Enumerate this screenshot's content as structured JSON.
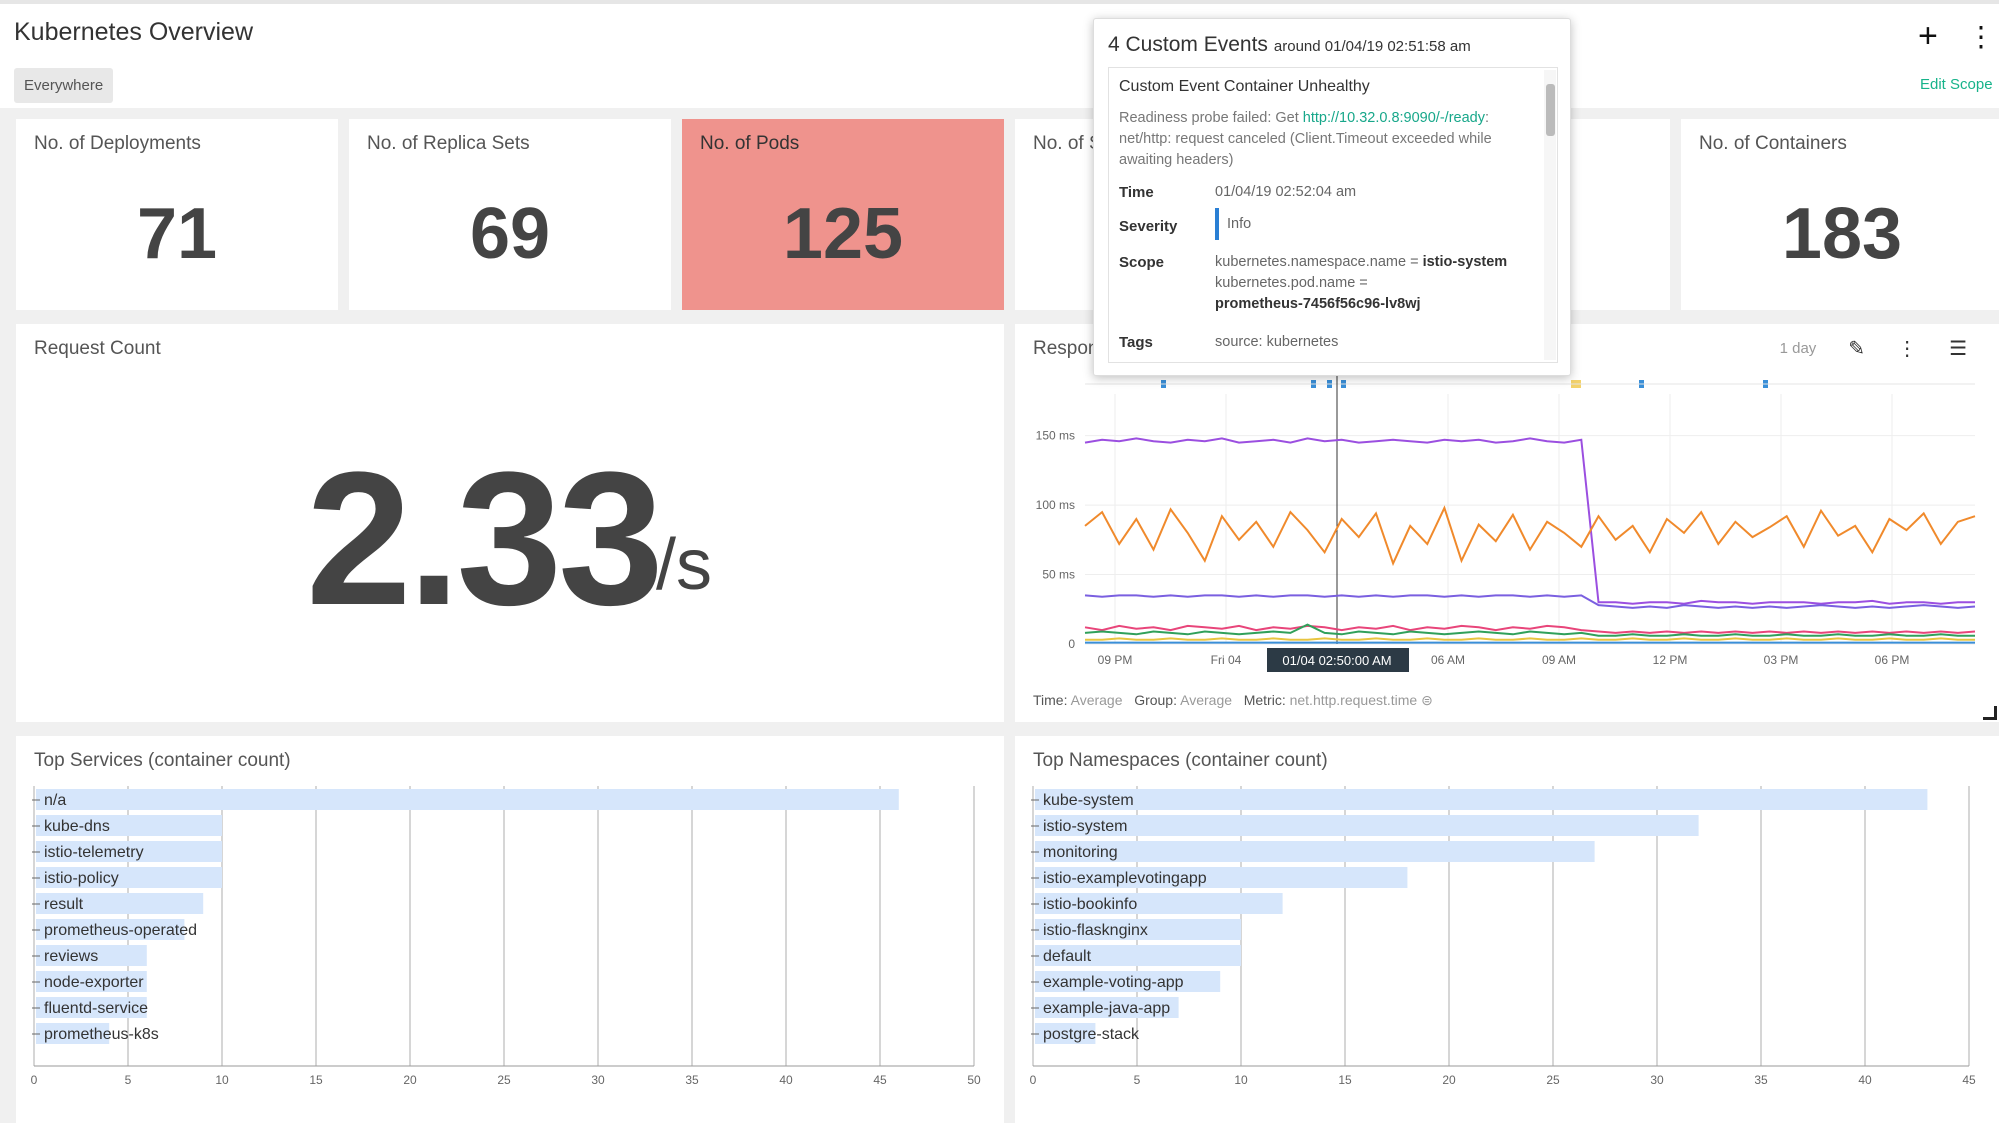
{
  "header": {
    "title": "Kubernetes Overview",
    "scope_chip": "Everywhere",
    "add_icon": "plus-icon",
    "more_icon": "more-vertical-icon",
    "edit_scope": "Edit Scope"
  },
  "tiles": [
    {
      "title": "No. of Deployments",
      "value": "71"
    },
    {
      "title": "No. of Replica Sets",
      "value": "69"
    },
    {
      "title": "No. of Pods",
      "value": "125",
      "highlight": "#ef938d"
    },
    {
      "title": "No. of S",
      "value": ""
    },
    {
      "title": "",
      "value": ""
    },
    {
      "title": "No. of Containers",
      "value": "183"
    }
  ],
  "request_count": {
    "title": "Request Count",
    "value": "2.33",
    "unit": "/s"
  },
  "response_chart": {
    "title_fragment": "Respon",
    "range": "1 day",
    "edit_icon": "pencil-icon",
    "more_icon": "more-vertical-icon",
    "legend_icon": "list-icon",
    "footer": {
      "time_label": "Time:",
      "time_value": "Average",
      "group_label": "Group:",
      "group_value": "Average",
      "metric_label": "Metric:",
      "metric_value": "net.http.request.time"
    },
    "cursor_label": "01/04 02:50:00 AM"
  },
  "event_popup": {
    "title": "4 Custom Events",
    "subtitle": "around 01/04/19 02:51:58 am",
    "event_name": "Custom Event Container Unhealthy",
    "desc_prefix": "Readiness probe failed: Get ",
    "desc_link": "http://10.32.0.8:9090/-/ready",
    "desc_suffix": ": net/http: request canceled (Client.Timeout exceeded while awaiting headers)",
    "time_label": "Time",
    "time_value": "01/04/19 02:52:04 am",
    "severity_label": "Severity",
    "severity_value": "Info",
    "scope_label": "Scope",
    "scope_line1": "kubernetes.namespace.name = ",
    "scope_line1_val": "istio-system",
    "scope_line2": "kubernetes.pod.name =",
    "scope_line3": "prometheus-7456f56c96-lv8wj",
    "tags_label": "Tags",
    "tags_value": "source: kubernetes"
  },
  "chart_data": [
    {
      "type": "line",
      "title": "",
      "ylabel": "",
      "y_ticks": [
        "0",
        "50 ms",
        "100 ms",
        "150 ms"
      ],
      "ylim": [
        0,
        180
      ],
      "x_ticks": [
        "09 PM",
        "Fri 04",
        "01/04 02:50:00 AM",
        "06 AM",
        "09 AM",
        "12 PM",
        "03 PM",
        "06 PM"
      ],
      "series": [
        {
          "color": "#9b4fe0",
          "values": [
            145,
            147,
            146,
            148,
            146,
            145,
            147,
            146,
            148,
            145,
            146,
            147,
            145,
            148,
            146,
            147,
            145,
            146,
            147,
            146,
            145,
            147,
            146,
            147,
            145,
            146,
            148,
            146,
            145,
            147,
            30,
            30,
            29,
            30,
            30,
            29,
            31,
            30,
            30,
            29,
            30,
            30,
            30,
            29,
            30,
            30,
            31,
            29,
            30,
            30,
            29,
            30,
            30
          ]
        },
        {
          "color": "#f08a2c",
          "values": [
            85,
            95,
            72,
            90,
            68,
            97,
            80,
            60,
            92,
            75,
            88,
            70,
            95,
            82,
            66,
            90,
            77,
            94,
            58,
            85,
            72,
            98,
            60,
            86,
            74,
            93,
            68,
            88,
            80,
            70,
            92,
            75,
            85,
            66,
            90,
            80,
            95,
            72,
            88,
            77,
            84,
            92,
            70,
            96,
            78,
            85,
            66,
            90,
            82,
            94,
            72,
            88,
            92
          ]
        },
        {
          "color": "#7a5fe0",
          "values": [
            35,
            34,
            35,
            35,
            34,
            35,
            34,
            35,
            35,
            34,
            35,
            34,
            35,
            35,
            34,
            35,
            34,
            35,
            34,
            35,
            35,
            34,
            35,
            34,
            35,
            35,
            34,
            35,
            34,
            35,
            28,
            27,
            26,
            27,
            26,
            28,
            27,
            26,
            27,
            26,
            27,
            26,
            27,
            28,
            27,
            26,
            27,
            26,
            27,
            28,
            27,
            26,
            27
          ]
        },
        {
          "color": "#e8457a",
          "values": [
            12,
            10,
            13,
            11,
            12,
            10,
            13,
            12,
            11,
            13,
            10,
            12,
            11,
            13,
            12,
            10,
            12,
            11,
            13,
            10,
            12,
            11,
            13,
            12,
            10,
            12,
            11,
            13,
            12,
            10,
            9,
            8,
            9,
            8,
            9,
            8,
            9,
            8,
            9,
            8,
            9,
            8,
            9,
            8,
            9,
            8,
            9,
            8,
            9,
            8,
            9,
            8,
            9
          ]
        },
        {
          "color": "#30a05a",
          "values": [
            8,
            9,
            8,
            7,
            9,
            8,
            7,
            9,
            8,
            7,
            8,
            9,
            8,
            14,
            8,
            7,
            9,
            8,
            7,
            9,
            8,
            7,
            8,
            9,
            8,
            7,
            9,
            8,
            7,
            8,
            6,
            6,
            7,
            6,
            6,
            7,
            6,
            6,
            7,
            6,
            6,
            7,
            6,
            6,
            7,
            6,
            6,
            7,
            6,
            6,
            7,
            6,
            6
          ]
        },
        {
          "color": "#e8c540",
          "values": [
            3,
            3,
            4,
            3,
            3,
            4,
            3,
            3,
            4,
            3,
            3,
            4,
            3,
            3,
            4,
            3,
            3,
            4,
            3,
            3,
            4,
            3,
            3,
            4,
            3,
            3,
            4,
            3,
            3,
            4,
            3,
            3,
            4,
            3,
            3,
            4,
            3,
            3,
            4,
            3,
            3,
            4,
            3,
            3,
            4,
            3,
            3,
            4,
            3,
            3,
            4,
            3,
            3
          ]
        },
        {
          "color": "#3a8fd8",
          "values": [
            1,
            1,
            1,
            1,
            1,
            1,
            1,
            1,
            1,
            1,
            1,
            1,
            1,
            1,
            1,
            1,
            1,
            1,
            1,
            1,
            1,
            1,
            1,
            1,
            1,
            1,
            1,
            1,
            1,
            1,
            1,
            1,
            1,
            1,
            1,
            1,
            1,
            1,
            1,
            1,
            1,
            1,
            1,
            1,
            1,
            1,
            1,
            1,
            1,
            1,
            1,
            1,
            1
          ]
        }
      ]
    },
    {
      "type": "bar",
      "title": "Top Services (container count)",
      "categories": [
        "n/a",
        "kube-dns",
        "istio-telemetry",
        "istio-policy",
        "result",
        "prometheus-operated",
        "reviews",
        "node-exporter",
        "fluentd-service",
        "prometheus-k8s"
      ],
      "values": [
        46,
        10,
        10,
        10,
        9,
        8,
        6,
        6,
        6,
        4
      ],
      "xlim": [
        0,
        50
      ],
      "x_ticks": [
        0,
        5,
        10,
        15,
        20,
        25,
        30,
        35,
        40,
        45,
        50
      ],
      "bar_color": "#d6e6fb"
    },
    {
      "type": "bar",
      "title": "Top Namespaces (container count)",
      "categories": [
        "kube-system",
        "istio-system",
        "monitoring",
        "istio-examplevotingapp",
        "istio-bookinfo",
        "istio-flasknginx",
        "default",
        "example-voting-app",
        "example-java-app",
        "postgre-stack"
      ],
      "values": [
        43,
        32,
        27,
        18,
        12,
        10,
        10,
        9,
        7,
        3
      ],
      "xlim": [
        0,
        45
      ],
      "x_ticks": [
        0,
        5,
        10,
        15,
        20,
        25,
        30,
        35,
        40,
        45
      ],
      "bar_color": "#d6e6fb"
    }
  ]
}
